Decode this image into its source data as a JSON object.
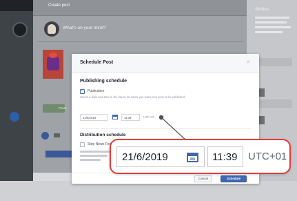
{
  "feed": {
    "create_post_label": "Create post",
    "whats_on_mind": "What's on your mind?",
    "photo_label": "Photo"
  },
  "sidebar_right": {
    "title": "Stories"
  },
  "modal": {
    "title": "Schedule Post",
    "close_glyph": "×",
    "publishing_heading": "Publishing schedule",
    "publication_label": "Publication",
    "publication_desc": "Select a date and time in the future for when you want your post to be published.",
    "date_value": "21/6/2019",
    "time_value": "11:39",
    "timezone": "UTC+01",
    "distribution_heading": "Distribution schedule",
    "stop_label": "Stop News Feed",
    "cancel_label": "Cancel",
    "schedule_label": "Schedule"
  },
  "magnified": {
    "date_value": "21/6/2019",
    "time_value": "11:39",
    "timezone": "UTC+01"
  },
  "colors": {
    "callout_border": "#e23b3b",
    "brand_blue": "#4267b2"
  }
}
